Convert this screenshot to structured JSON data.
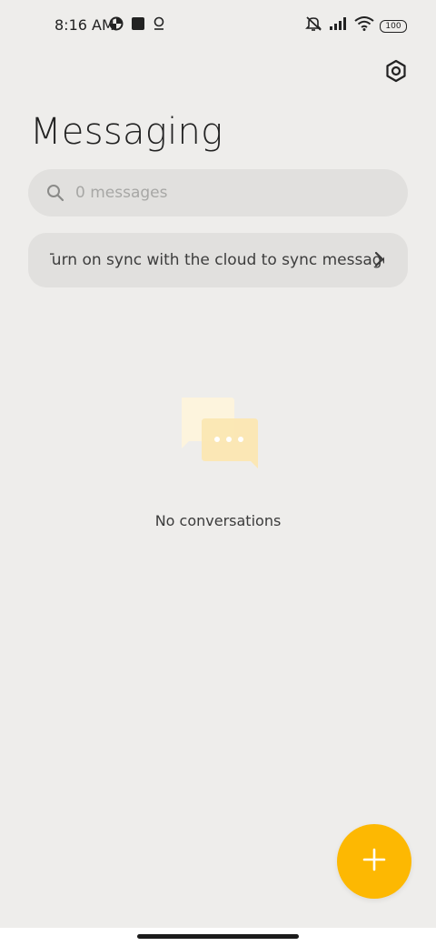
{
  "status_bar": {
    "time": "8:16 AM",
    "battery": "100",
    "left_icons": [
      "data-saver-icon",
      "square-icon",
      "location-icon"
    ],
    "right_icons": [
      "mute-icon",
      "signal-icon",
      "wifi-icon",
      "battery-icon"
    ]
  },
  "header": {
    "title": "Messaging",
    "settings_icon": "settings-hex-icon"
  },
  "search": {
    "placeholder": "0 messages",
    "value": ""
  },
  "sync_banner": {
    "text": "Turn on sync with the cloud to sync messages"
  },
  "empty_state": {
    "text": "No conversations",
    "illustration_icon": "chat-bubbles-icon"
  },
  "fab": {
    "icon": "plus-icon",
    "color": "#fdb802"
  },
  "colors": {
    "background": "#eeedeb",
    "surface": "#e1e0de",
    "accent": "#fdb802"
  }
}
